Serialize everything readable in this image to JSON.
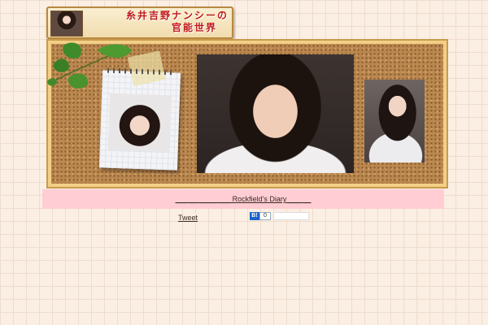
{
  "header": {
    "title_line1": "糸井吉野ナンシーの",
    "title_line2": "官能世界"
  },
  "diary": {
    "link_text": "___ __ ____ ___ Rockfield's Diary ___ __"
  },
  "share": {
    "tweet_label": "Tweet",
    "hatena_label": "B!",
    "hatena_count": "0"
  }
}
